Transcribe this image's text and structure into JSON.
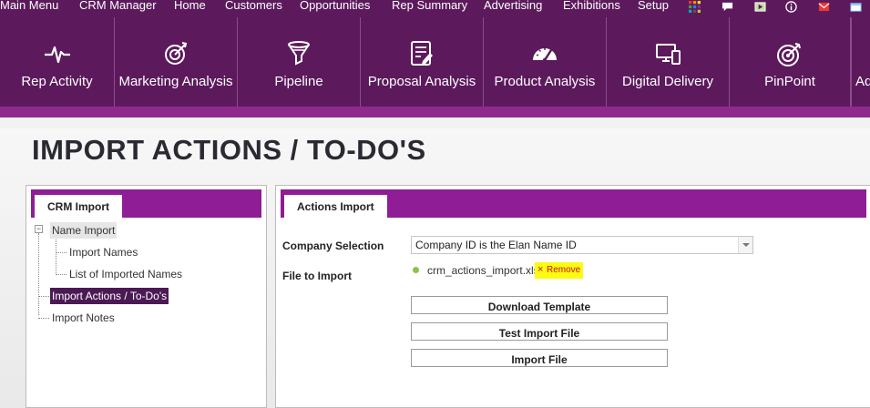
{
  "top_menu": {
    "items": [
      "Main Menu",
      "CRM Manager",
      "Home",
      "Customers",
      "Opportunities",
      "Rep Summary",
      "Advertising",
      "Exhibitions",
      "Setup"
    ],
    "icons": [
      "apps-grid-icon",
      "chat-icon",
      "video-icon",
      "info-icon",
      "mail-icon",
      "window-icon"
    ]
  },
  "modules": [
    {
      "label": "Rep Activity",
      "icon": "heartbeat-icon"
    },
    {
      "label": "Marketing Analysis",
      "icon": "target-arrow-icon"
    },
    {
      "label": "Pipeline",
      "icon": "funnel-icon"
    },
    {
      "label": "Proposal Analysis",
      "icon": "document-edit-icon"
    },
    {
      "label": "Product Analysis",
      "icon": "gauge-icon"
    },
    {
      "label": "Digital Delivery",
      "icon": "devices-icon"
    },
    {
      "label": "PinPoint",
      "icon": "bullseye-icon"
    },
    {
      "label": "Ad",
      "icon": ""
    }
  ],
  "page": {
    "title": "IMPORT ACTIONS / TO-DO'S"
  },
  "left_panel": {
    "tab": "CRM Import",
    "tree": [
      {
        "label": "Name Import",
        "expanded": true
      },
      {
        "label": "Import Names"
      },
      {
        "label": "List of Imported Names"
      },
      {
        "label": "Import Actions / To-Do's",
        "selected": true
      },
      {
        "label": "Import Notes"
      }
    ]
  },
  "right_panel": {
    "tab": "Actions Import",
    "company_selection_label": "Company Selection",
    "company_selection_value": "Company ID is the Elan Name ID",
    "file_label": "File to Import",
    "file_name": "crm_actions_import.xlsx",
    "remove_label": "Remove",
    "buttons": {
      "download": "Download Template",
      "test": "Test Import File",
      "import": "Import File"
    }
  },
  "colors": {
    "brand_dark": "#5c1a5c",
    "brand_accent": "#8e1d96",
    "selected_item": "#4b1a55",
    "highlight": "#fbfb13"
  }
}
